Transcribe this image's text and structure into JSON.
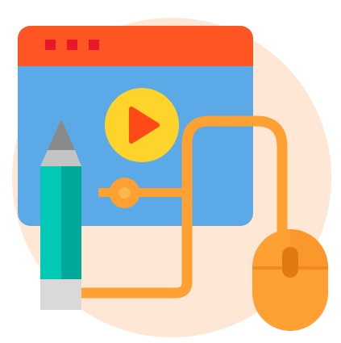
{
  "illustration": {
    "subject": "video-editing-icon",
    "colors": {
      "background_circle": "#FFE7D6",
      "window_titlebar": "#FF5522",
      "window_dots": "#E8182A",
      "window_body": "#5BA9E6",
      "play_circle": "#FFD42A",
      "play_triangle": "#FF4A1A",
      "slider": "#FFA033",
      "slider_knob_inner": "#FFB84D",
      "pencil_body_light": "#00C9B6",
      "pencil_body_dark": "#00A99A",
      "pencil_tip": "#8A8A8A",
      "pencil_wood": "#C4C4C4",
      "pencil_eraser": "#D9D9D9",
      "cable": "#FFA033",
      "mouse_body": "#FFA033",
      "mouse_body_dark": "#F08A1E",
      "mouse_wheel": "#E07A10"
    },
    "icons": [
      "browser-window-icon",
      "play-button-icon",
      "timeline-slider-icon",
      "pencil-icon",
      "mouse-icon"
    ],
    "slider_position": 0.3
  }
}
